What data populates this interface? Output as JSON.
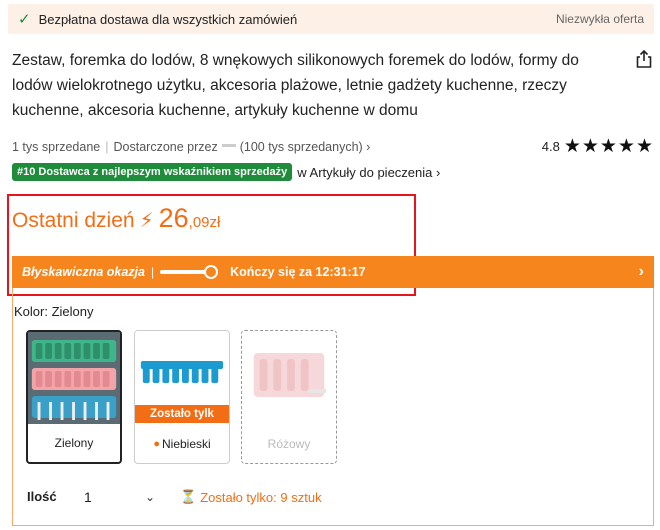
{
  "banner": {
    "check_icon": "check-icon",
    "shipping_text": "Bezpłatna dostawa dla wszystkich zamówień",
    "offer_text": "Niezwykła oferta"
  },
  "product": {
    "title": "Zestaw, foremka do lodów, 8 wnękowych silikonowych foremek do lodów, formy do lodów wielokrotnego użytku, akcesoria plażowe, letnie gadżety kuchenne, rzeczy kuchenne, akcesoria kuchenne, artykuły kuchenne w domu",
    "share_icon": "share-icon",
    "sold": "1 tys sprzedane",
    "delivered_by_prefix": "Dostarczone przez",
    "delivered_by_suffix": "(100 tys sprzedanych) ›",
    "rating": "4.8",
    "stars": "★★★★★",
    "rating_value": 5
  },
  "ranking": {
    "badge": "#10 Dostawca z najlepszym wskaźnikiem sprzedaży",
    "category_link": "w Artykuły do pieczenia ›"
  },
  "price": {
    "label": "Ostatni dzień",
    "bolt_icon": "lightning-icon",
    "main": "26",
    "fraction": ",09zł"
  },
  "flash_sale": {
    "name": "Błyskawiczna okazja",
    "separator": "|",
    "ends_text": "Kończy się za 12:31:17",
    "chevron": "›"
  },
  "variants": {
    "label": "Kolor: Zielony",
    "options": [
      {
        "name": "Zielony",
        "selected": true,
        "available": true
      },
      {
        "name": "Niebieski",
        "tag": "Zostało tylk",
        "selected": false,
        "available": true
      },
      {
        "name": "Różowy",
        "selected": false,
        "available": false
      }
    ]
  },
  "quantity": {
    "label": "Ilość",
    "value": "1",
    "stock_text": "Zostało tylko: 9 sztuk"
  },
  "colors": {
    "accent": "#f36d15",
    "flash_bar": "#f7851e",
    "badge_green": "#1e8c3a",
    "highlight_red": "#e8141b",
    "banner_bg": "#fdf0e6"
  }
}
